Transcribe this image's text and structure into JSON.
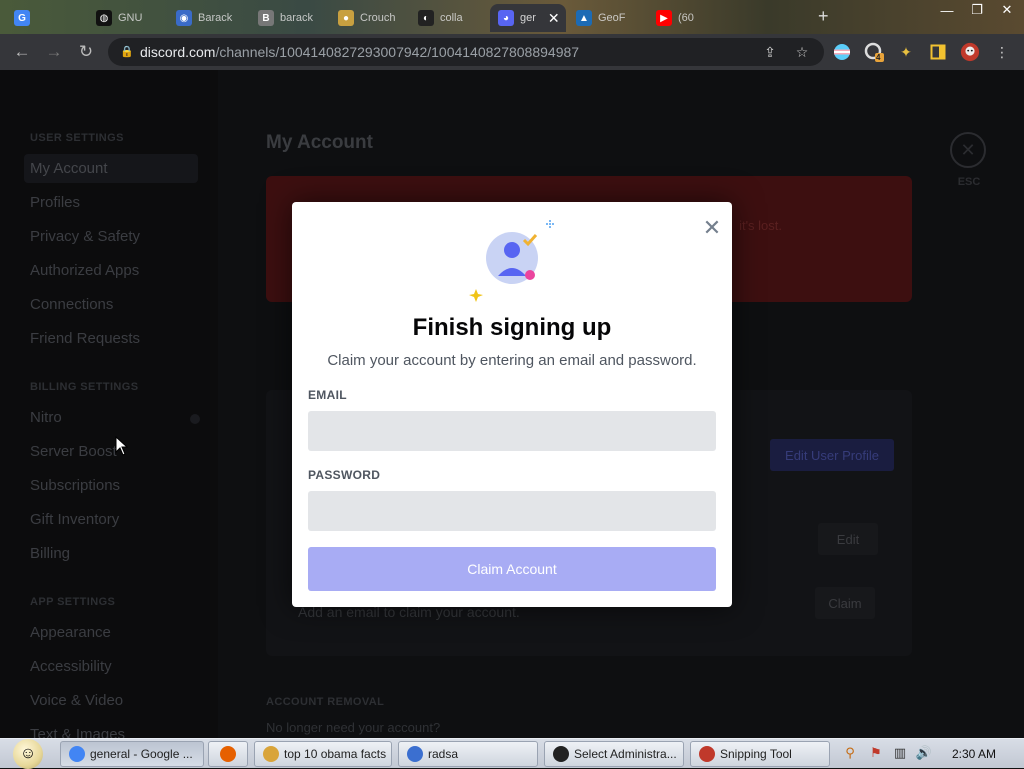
{
  "browser": {
    "tabs": [
      {
        "title": "",
        "favicon": "google-icon",
        "color": "#4285f4",
        "glyph": "G"
      },
      {
        "title": "GNU",
        "favicon": "gnu-icon",
        "color": "#111111",
        "glyph": "◍"
      },
      {
        "title": "Barack",
        "favicon": "wiki-icon",
        "color": "#3a6bc8",
        "glyph": "◉"
      },
      {
        "title": "barack",
        "favicon": "bookmark-icon",
        "color": "#777777",
        "glyph": "B"
      },
      {
        "title": "Crouch",
        "favicon": "coin-icon",
        "color": "#c8a040",
        "glyph": "●"
      },
      {
        "title": "colla",
        "favicon": "github-icon",
        "color": "#222222",
        "glyph": "◐"
      },
      {
        "title": "ger",
        "favicon": "discord-icon",
        "color": "#5865f2",
        "glyph": "◕",
        "active": true
      },
      {
        "title": "GeoF",
        "favicon": "geo-icon",
        "color": "#1c6bb5",
        "glyph": "▲"
      },
      {
        "title": "(60",
        "favicon": "youtube-icon",
        "color": "#ff0000",
        "glyph": "▶"
      }
    ],
    "new_tab": "+",
    "url_domain": "discord.com",
    "url_path": "/channels/1004140827293007942/1004140827808894987",
    "extension_badge": "4"
  },
  "discord": {
    "user_settings_heading": "USER SETTINGS",
    "user_settings": [
      "My Account",
      "Profiles",
      "Privacy & Safety",
      "Authorized Apps",
      "Connections",
      "Friend Requests"
    ],
    "billing_heading": "BILLING SETTINGS",
    "billing": [
      "Nitro",
      "Server Boost",
      "Subscriptions",
      "Gift Inventory",
      "Billing"
    ],
    "app_heading": "APP SETTINGS",
    "app": [
      "Appearance",
      "Accessibility",
      "Voice & Video",
      "Text & Images"
    ],
    "main_title": "My Account",
    "banner_tail": "it's lost.",
    "edit_profile": "Edit User Profile",
    "edit": "Edit",
    "claim": "Claim",
    "claim_hint": "Add an email to claim your account.",
    "account_removal": "ACCOUNT REMOVAL",
    "account_removal_sub": "No longer need your account?",
    "esc_label": "ESC"
  },
  "modal": {
    "title": "Finish signing up",
    "subtitle": "Claim your account by entering an email and password.",
    "email_label": "EMAIL",
    "email_value": "",
    "password_label": "PASSWORD",
    "password_value": "",
    "submit": "Claim Account",
    "accent": "#a8acf4"
  },
  "taskbar": {
    "items": [
      {
        "label": "general - Google ...",
        "icon": "chrome-icon",
        "color": "#4285f4",
        "active": true
      },
      {
        "label": "",
        "icon": "firefox-icon",
        "color": "#e66000"
      },
      {
        "label": "top 10 obama facts",
        "icon": "folder-icon",
        "color": "#d9a43a"
      },
      {
        "label": "radsa",
        "icon": "app-icon",
        "color": "#3b6fd0"
      },
      {
        "label": "Select Administra...",
        "icon": "cmd-icon",
        "color": "#222222"
      },
      {
        "label": "Snipping Tool",
        "icon": "scissors-icon",
        "color": "#c0392b"
      }
    ],
    "clock": "2:30 AM"
  }
}
